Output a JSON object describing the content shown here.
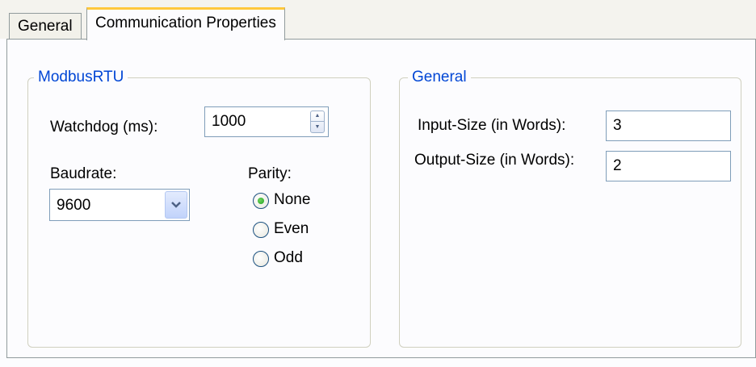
{
  "tabs": [
    {
      "label": "General",
      "active": false
    },
    {
      "label": "Communication Properties",
      "active": true
    }
  ],
  "modbus_group": {
    "title": "ModbusRTU",
    "watchdog": {
      "label": "Watchdog (ms):",
      "value": "1000"
    },
    "baudrate": {
      "label": "Baudrate:",
      "value": "9600"
    },
    "parity": {
      "label": "Parity:",
      "options": [
        "None",
        "Even",
        "Odd"
      ],
      "selected": "None"
    }
  },
  "general_group": {
    "title": "General",
    "input_size": {
      "label": "Input-Size (in Words):",
      "value": "3"
    },
    "output_size": {
      "label": "Output-Size (in Words):",
      "value": "2"
    }
  },
  "colors": {
    "group_title": "#0046d5",
    "active_tab_highlight": "#ffc83c",
    "radio_checked": "#21a121"
  }
}
